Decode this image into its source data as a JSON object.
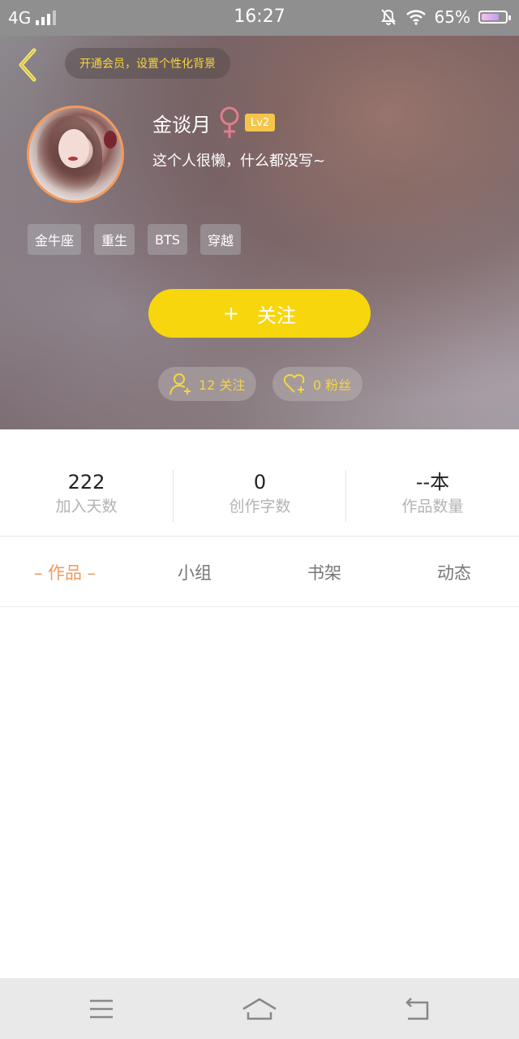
{
  "status_bar": {
    "network": "4G",
    "time": "16:27",
    "battery": "65%"
  },
  "header": {
    "vip_banner": "开通会员，设置个性化背景"
  },
  "profile": {
    "username": "金谈月",
    "level": "Lv2",
    "bio": "这个人很懒，什么都没写~",
    "tags": [
      "金牛座",
      "重生",
      "BTS",
      "穿越"
    ],
    "follow_button": {
      "icon": "+",
      "label": "关注"
    },
    "following": "12 关注",
    "fans": "0 粉丝"
  },
  "stats": [
    {
      "value": "222",
      "label": "加入天数"
    },
    {
      "value": "0",
      "label": "创作字数"
    },
    {
      "value": "--本",
      "label": "作品数量"
    }
  ],
  "tabs": [
    {
      "label": "– 作品 –",
      "active": true
    },
    {
      "label": "小组",
      "active": false
    },
    {
      "label": "书架",
      "active": false
    },
    {
      "label": "动态",
      "active": false
    }
  ],
  "colors": {
    "accent": "#F7D60E",
    "active_tab": "#F29A5D",
    "vip_text": "#F6D53E"
  }
}
